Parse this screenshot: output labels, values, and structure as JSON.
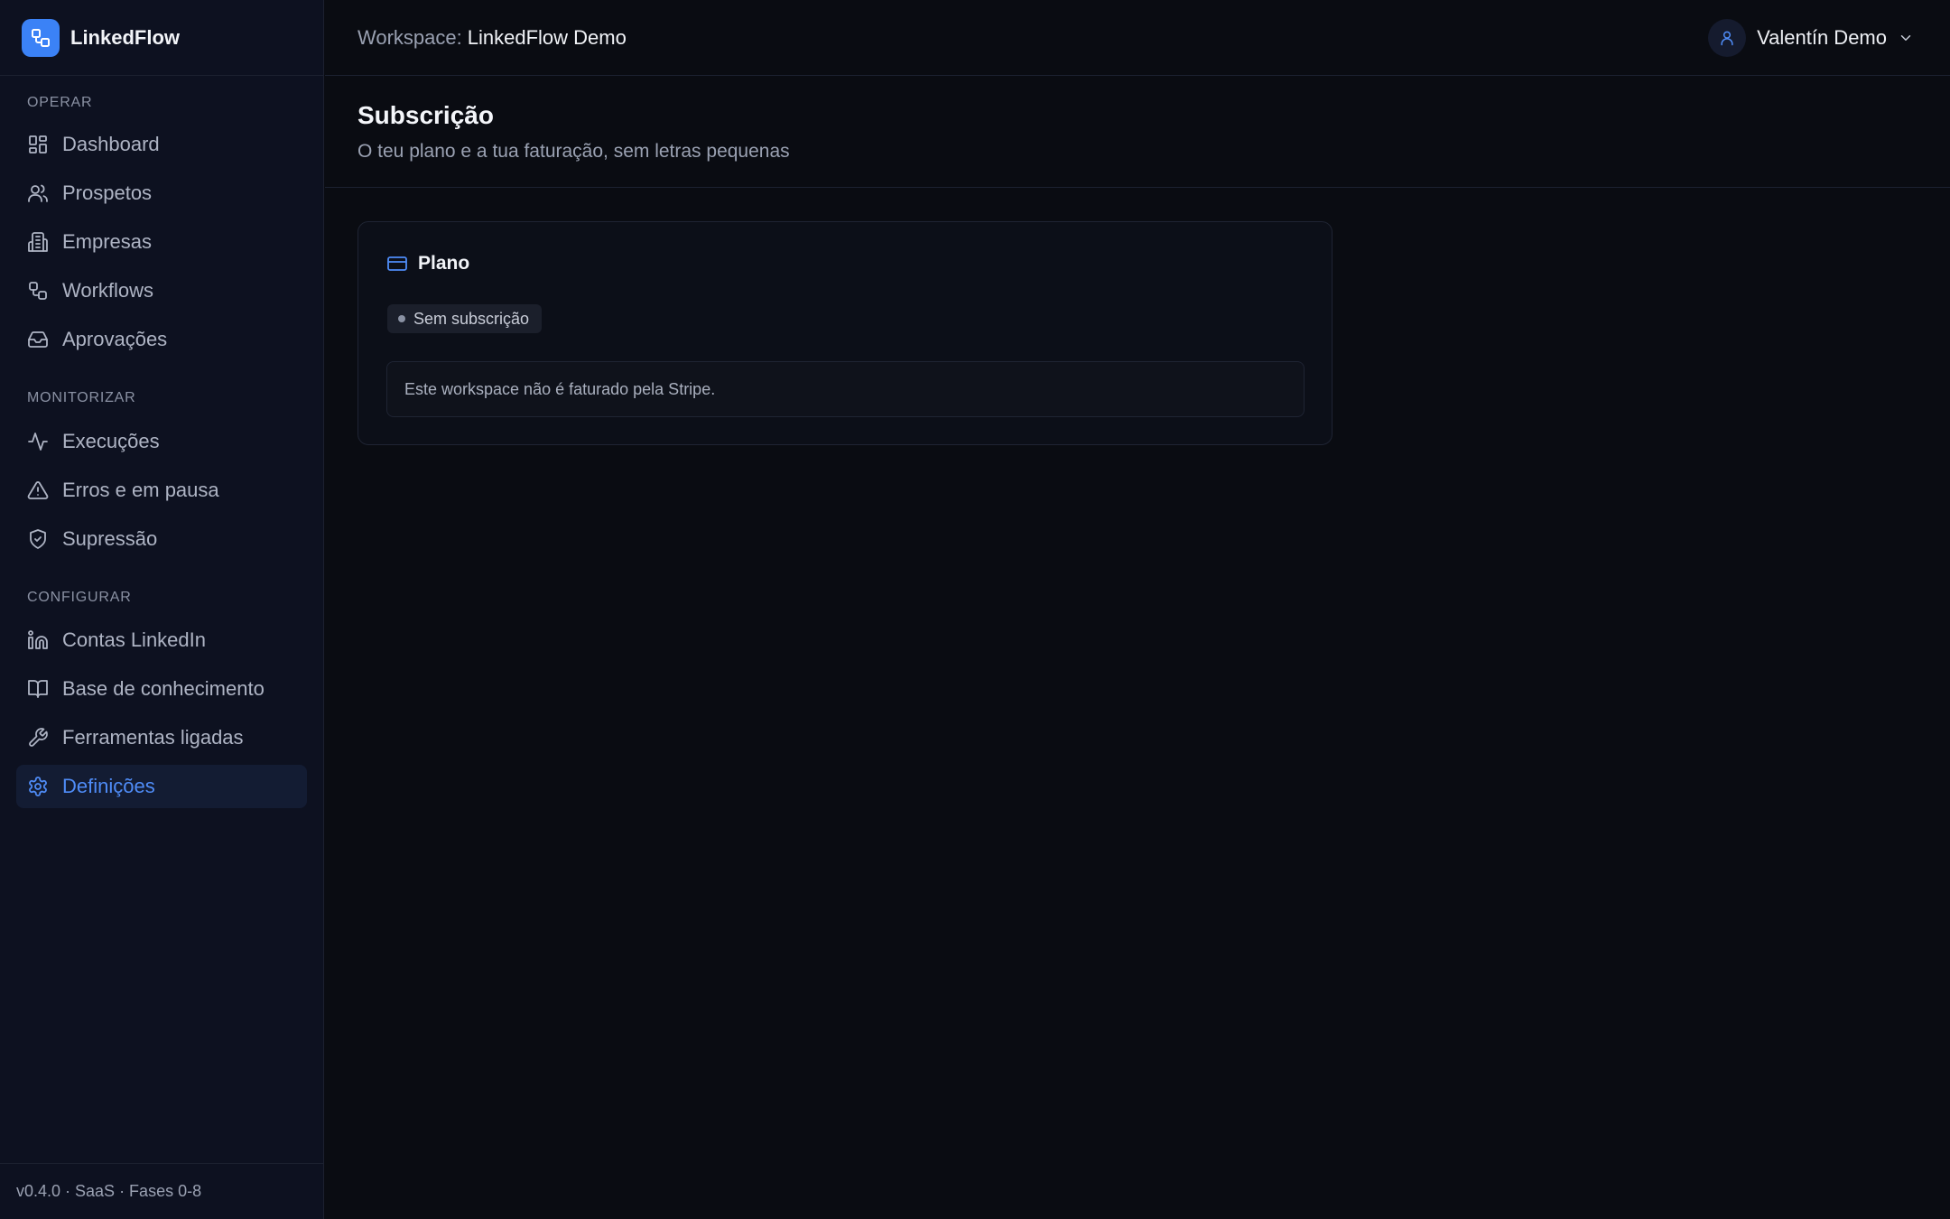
{
  "app": {
    "name": "LinkedFlow"
  },
  "sidebar": {
    "sections": [
      {
        "title": "OPERAR",
        "items": [
          {
            "label": "Dashboard",
            "icon": "dashboard-icon"
          },
          {
            "label": "Prospetos",
            "icon": "users-icon"
          },
          {
            "label": "Empresas",
            "icon": "building-icon"
          },
          {
            "label": "Workflows",
            "icon": "workflow-icon"
          },
          {
            "label": "Aprovações",
            "icon": "inbox-icon"
          }
        ]
      },
      {
        "title": "MONITORIZAR",
        "items": [
          {
            "label": "Execuções",
            "icon": "activity-icon"
          },
          {
            "label": "Erros e em pausa",
            "icon": "alert-triangle-icon"
          },
          {
            "label": "Supressão",
            "icon": "shield-check-icon"
          }
        ]
      },
      {
        "title": "CONFIGURAR",
        "items": [
          {
            "label": "Contas LinkedIn",
            "icon": "linkedin-icon"
          },
          {
            "label": "Base de conhecimento",
            "icon": "book-icon"
          },
          {
            "label": "Ferramentas ligadas",
            "icon": "wrench-icon"
          },
          {
            "label": "Definições",
            "icon": "gear-icon",
            "active": true
          }
        ]
      }
    ],
    "footer": "v0.4.0 · SaaS · Fases 0-8"
  },
  "topbar": {
    "workspace_label": "Workspace:",
    "workspace_name": "LinkedFlow Demo",
    "user_name": "Valentín Demo"
  },
  "page": {
    "title": "Subscrição",
    "subtitle": "O teu plano e a tua faturação, sem letras pequenas"
  },
  "plan_card": {
    "title": "Plano",
    "status_badge": "Sem subscrição",
    "notice": "Este workspace não é faturado pela Stripe."
  },
  "colors": {
    "accent": "#3b82f6",
    "active_text": "#4f8cf7",
    "background": "#0a0c12",
    "sidebar_background": "#0d1120"
  }
}
